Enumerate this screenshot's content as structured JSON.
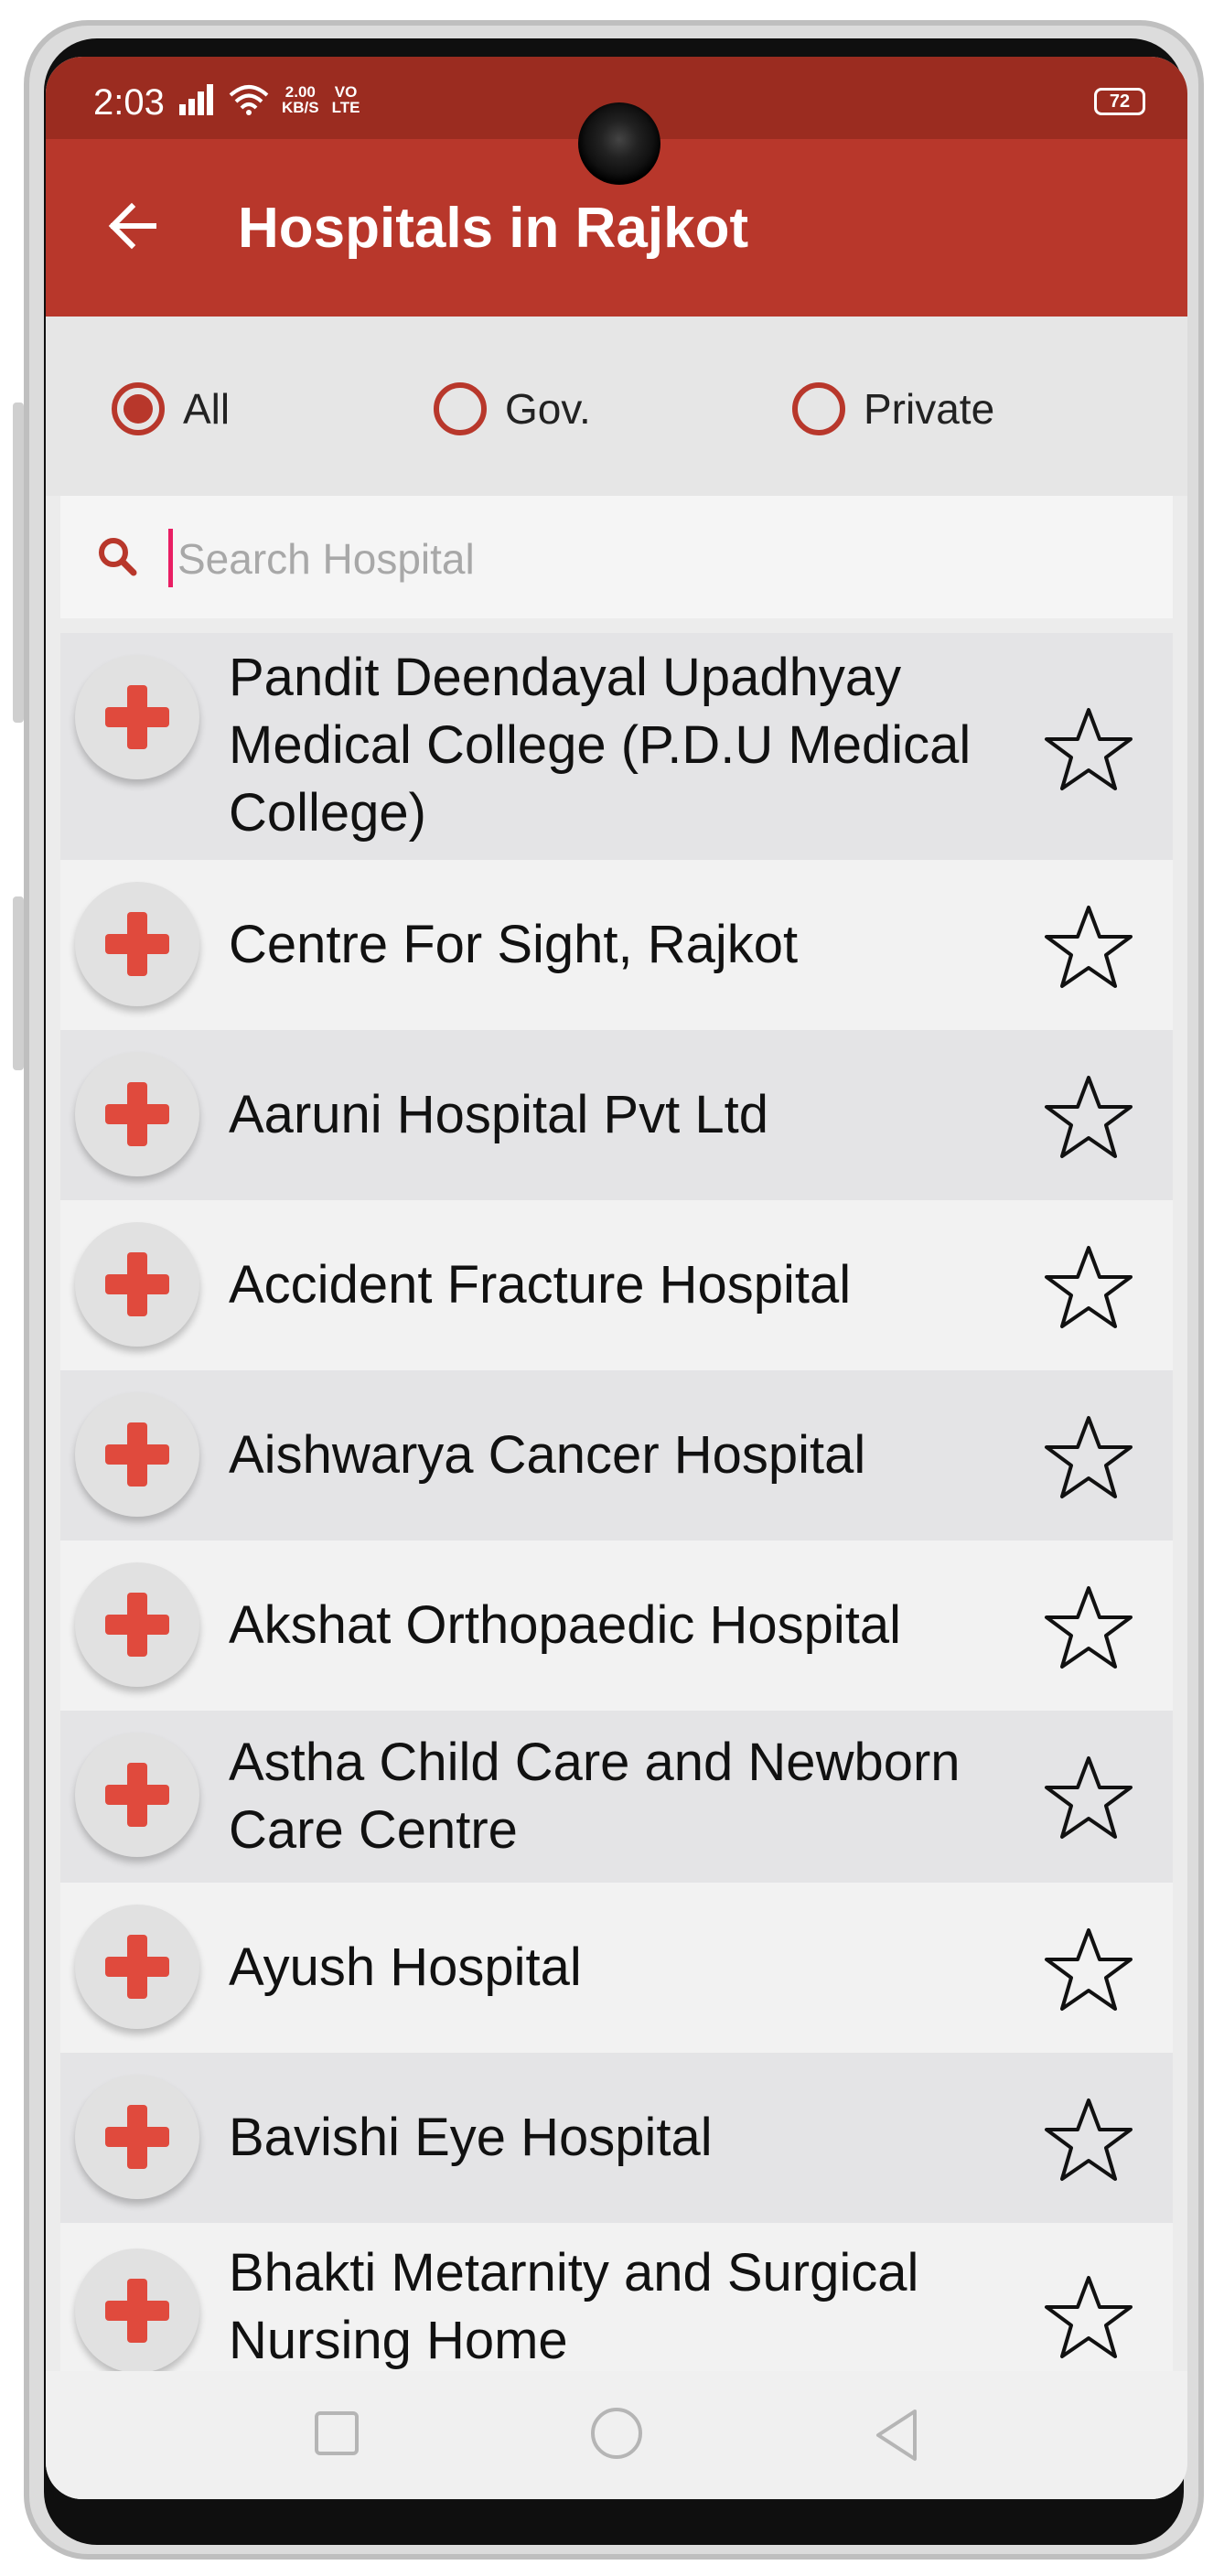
{
  "status_bar": {
    "time": "2:03",
    "net_speed_value": "2.00",
    "net_speed_unit": "KB/S",
    "volte_top": "VO",
    "volte_bottom": "LTE",
    "battery": "72"
  },
  "app_bar": {
    "title": "Hospitals in Rajkot",
    "back_icon": "arrow-left-icon"
  },
  "filters": {
    "options": [
      {
        "label": "All",
        "selected": true
      },
      {
        "label": "Gov.",
        "selected": false
      },
      {
        "label": "Private",
        "selected": false
      }
    ]
  },
  "search": {
    "placeholder": "Search Hospital",
    "value": "",
    "icon": "search-icon"
  },
  "hospitals": [
    {
      "name": "Pandit Deendayal Upadhyay Medical College (P.D.U Medical College)",
      "favorite": false
    },
    {
      "name": "Centre For Sight, Rajkot",
      "favorite": false
    },
    {
      "name": "Aaruni Hospital Pvt Ltd",
      "favorite": false
    },
    {
      "name": "Accident Fracture Hospital",
      "favorite": false
    },
    {
      "name": "Aishwarya Cancer Hospital",
      "favorite": false
    },
    {
      "name": "Akshat Orthopaedic Hospital",
      "favorite": false
    },
    {
      "name": "Astha Child Care and Newborn Care Centre",
      "favorite": false
    },
    {
      "name": "Ayush Hospital",
      "favorite": false
    },
    {
      "name": "Bavishi Eye Hospital",
      "favorite": false
    },
    {
      "name": "Bhakti Metarnity and Surgical Nursing Home",
      "favorite": false
    }
  ],
  "colors": {
    "accent": "#b8372b",
    "status_bar": "#9b2c20",
    "cross": "#e04a3d"
  },
  "nav": {
    "recents_icon": "square-icon",
    "home_icon": "circle-icon",
    "back_icon": "triangle-back-icon"
  }
}
